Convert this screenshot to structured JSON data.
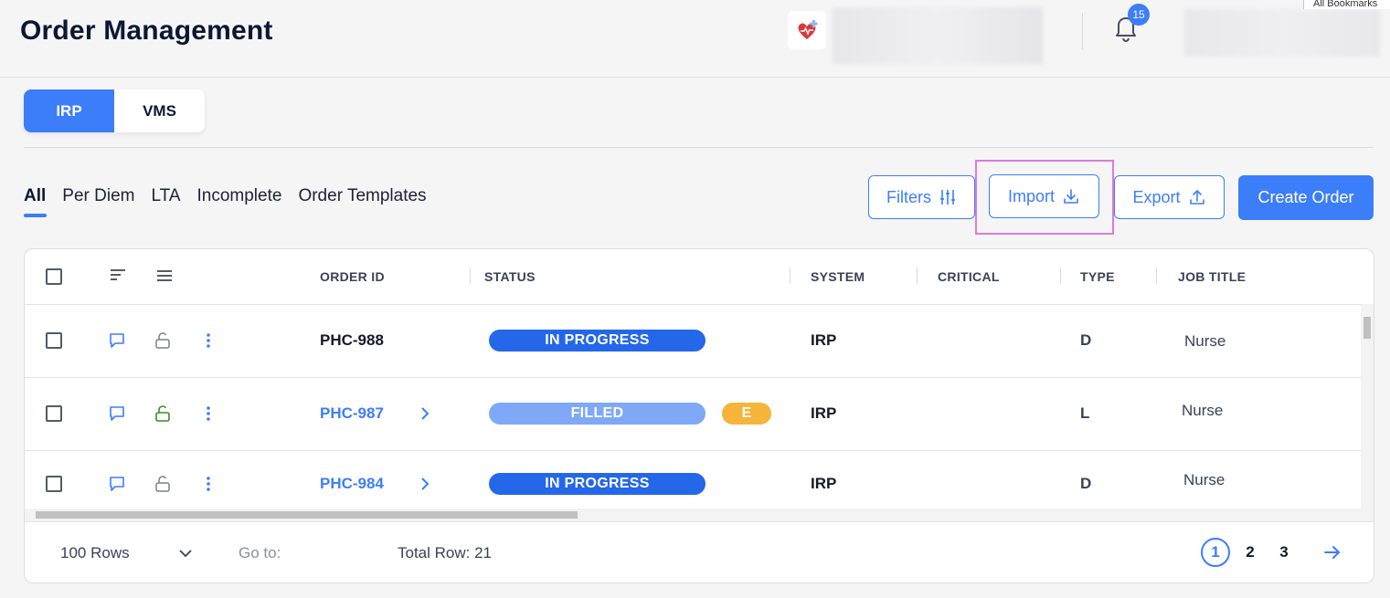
{
  "header": {
    "title": "Order Management",
    "notification_count": "15",
    "bookmarks_label": "All Bookmarks"
  },
  "system_toggle": {
    "options": [
      "IRP",
      "VMS"
    ],
    "selected": "IRP"
  },
  "tabs": [
    {
      "label": "All",
      "active": true
    },
    {
      "label": "Per Diem",
      "active": false
    },
    {
      "label": "LTA",
      "active": false
    },
    {
      "label": "Incomplete",
      "active": false
    },
    {
      "label": "Order Templates",
      "active": false
    }
  ],
  "toolbar": {
    "filters_label": "Filters",
    "import_label": "Import",
    "export_label": "Export",
    "create_label": "Create Order"
  },
  "table": {
    "columns": [
      "ORDER ID",
      "STATUS",
      "SYSTEM",
      "CRITICAL",
      "TYPE",
      "JOB TITLE"
    ],
    "rows": [
      {
        "order_id": "PHC-988",
        "status": "IN PROGRESS",
        "badge": "",
        "system": "IRP",
        "critical": "",
        "type": "D",
        "job_title": "Nurse",
        "unlocked": false
      },
      {
        "order_id": "PHC-987",
        "status": "FILLED",
        "badge": "E",
        "system": "IRP",
        "critical": "",
        "type": "L",
        "job_title": "Nurse",
        "unlocked": true
      },
      {
        "order_id": "PHC-984",
        "status": "IN PROGRESS",
        "badge": "",
        "system": "IRP",
        "critical": "",
        "type": "D",
        "job_title": "Nurse",
        "unlocked": false
      }
    ]
  },
  "footer": {
    "rows_per_page": "100 Rows",
    "goto_label": "Go to:",
    "total_rows_text": "Total Row: 21",
    "pages": [
      "1",
      "2",
      "3"
    ],
    "current_page": "1"
  },
  "colors": {
    "primary": "#3c7ef9",
    "in_progress": "#2467e8",
    "filled": "#7fa9f7",
    "badge_e": "#f5b43a",
    "highlight": "#de7ad8"
  }
}
